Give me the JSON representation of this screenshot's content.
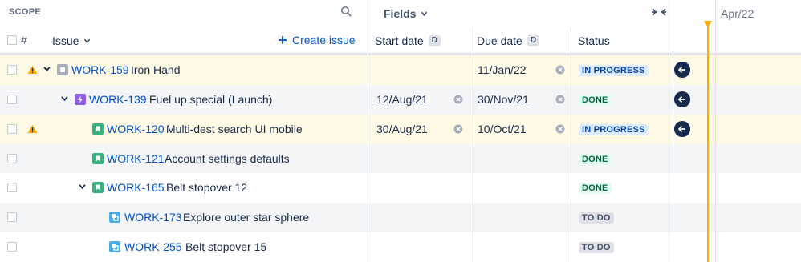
{
  "header": {
    "scope_label": "SCOPE",
    "fields_label": "Fields",
    "month_label": "Apr/22",
    "hash_label": "#",
    "issue_label": "Issue",
    "create_label": "Create issue",
    "start_date_label": "Start date",
    "due_date_label": "Due date",
    "date_badge": "D",
    "status_label": "Status"
  },
  "rows": [
    {
      "key": "WORK-159",
      "summary": "Iron Hand",
      "start": "",
      "due": "11/Jan/22",
      "status": "IN PROGRESS",
      "type": "epic",
      "warning": true,
      "level": 0
    },
    {
      "key": "WORK-139",
      "summary": "Fuel up special (Launch)",
      "start": "12/Aug/21",
      "due": "30/Nov/21",
      "status": "DONE",
      "type": "subtask-lightning",
      "warning": false,
      "level": 1
    },
    {
      "key": "WORK-120",
      "summary": "Multi-dest search UI mobile",
      "start": "30/Aug/21",
      "due": "10/Oct/21",
      "status": "IN PROGRESS",
      "type": "story",
      "warning": true,
      "level": 2
    },
    {
      "key": "WORK-121",
      "summary": "Account settings defaults",
      "start": "",
      "due": "",
      "status": "DONE",
      "type": "story",
      "warning": false,
      "level": 2
    },
    {
      "key": "WORK-165",
      "summary": "Belt stopover 12",
      "start": "",
      "due": "",
      "status": "DONE",
      "type": "story",
      "warning": false,
      "level": 2
    },
    {
      "key": "WORK-173",
      "summary": "Explore outer star sphere",
      "start": "",
      "due": "",
      "status": "TO DO",
      "type": "task",
      "warning": false,
      "level": 3
    },
    {
      "key": "WORK-255",
      "summary": "Belt stopover 15",
      "start": "",
      "due": "",
      "status": "TO DO",
      "type": "task",
      "warning": false,
      "level": 3
    }
  ],
  "colors": {
    "link": "#0052CC",
    "warning": "#FFAB00",
    "today_line": "#FFAB00",
    "story": "#36B37E",
    "task": "#4BADE8",
    "subtask": "#8F5CE6",
    "epic": "#A5ADBA"
  }
}
